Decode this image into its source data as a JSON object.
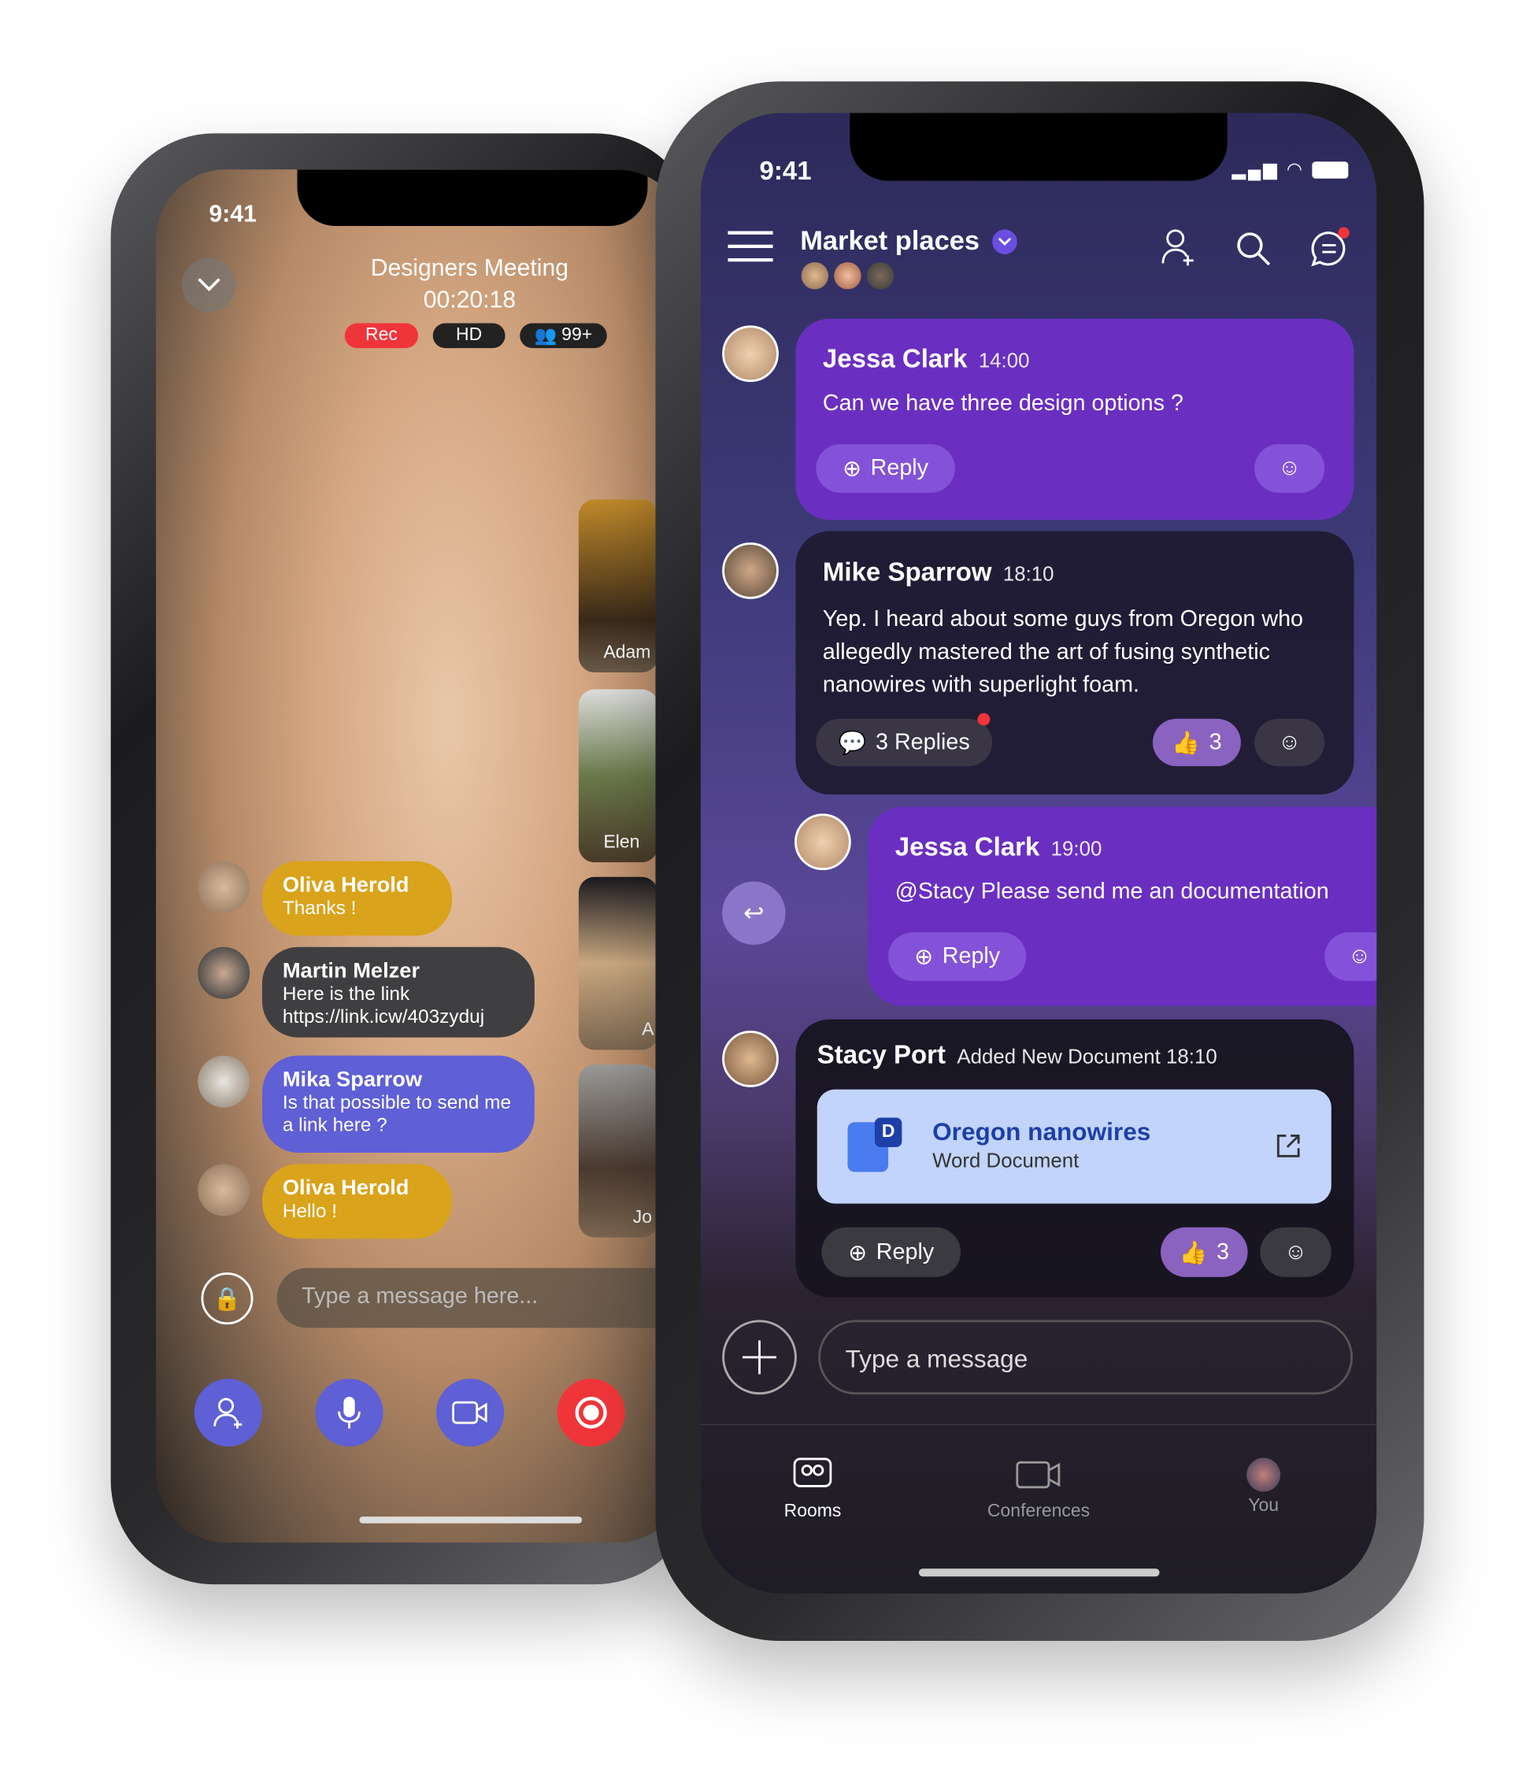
{
  "call": {
    "time": "9:41",
    "title": "Designers Meeting",
    "timer": "00:20:18",
    "badges": {
      "rec": "Rec",
      "hd": "HD",
      "participants": "99+"
    },
    "thumbnails": [
      "Adam",
      "Elen",
      "A",
      "Jo"
    ],
    "chat": [
      {
        "name": "Oliva Herold",
        "text": "Thanks !",
        "color": "#d9a31b"
      },
      {
        "name": "Martin Melzer",
        "text": "Here is the link",
        "link": "https://link.icw/403zyduj",
        "color": "#3f3f42"
      },
      {
        "name": "Mika Sparrow",
        "text": "Is that possible to send me a link here ?",
        "color": "#5f5fd6"
      },
      {
        "name": "Oliva Herold",
        "text": "Hello !",
        "color": "#d9a31b"
      }
    ],
    "input_placeholder": "Type a message here...",
    "controls": [
      "add-participant",
      "microphone",
      "camera",
      "record"
    ]
  },
  "chat_app": {
    "time": "9:41",
    "header": {
      "title": "Market places"
    },
    "messages": [
      {
        "name": "Jessa Clark",
        "time": "14:00",
        "text": "Can we have three design options ?",
        "reply": "Reply"
      },
      {
        "name": "Mike Sparrow",
        "time": "18:10",
        "text": "Yep. I heard about some guys from Oregon who allegedly mastered the art of fusing synthetic nanowires with superlight foam.",
        "replies": "3 Replies",
        "likes": "3"
      },
      {
        "name": "Jessa Clark",
        "time": "19:00",
        "text": "@Stacy Please send me an documentation",
        "reply": "Reply"
      },
      {
        "name": "Stacy Port",
        "meta": "Added New Document 18:10",
        "doc_title": "Oregon nanowires",
        "doc_type": "Word Document",
        "doc_badge": "D",
        "reply": "Reply",
        "likes": "3"
      }
    ],
    "input_placeholder": "Type a message",
    "tabs": [
      {
        "label": "Rooms",
        "active": true
      },
      {
        "label": "Conferences"
      },
      {
        "label": "You"
      }
    ],
    "colors": {
      "accent": "#6a2fc0",
      "dark_card": "#25203a",
      "doc_card": "#c2d4fc",
      "doc_title": "#1e3fa8"
    }
  }
}
